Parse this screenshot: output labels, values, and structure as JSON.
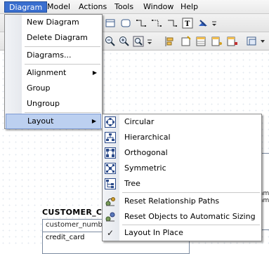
{
  "menubar": {
    "items": [
      {
        "label": "Diagram"
      },
      {
        "label": "Model"
      },
      {
        "label": "Actions"
      },
      {
        "label": "Tools"
      },
      {
        "label": "Window"
      },
      {
        "label": "Help"
      }
    ]
  },
  "diagram_menu": {
    "items": [
      {
        "label": "New Diagram"
      },
      {
        "label": "Delete Diagram"
      },
      {
        "label": "Diagrams..."
      },
      {
        "label": "Alignment"
      },
      {
        "label": "Group"
      },
      {
        "label": "Ungroup"
      },
      {
        "label": "Layout"
      }
    ]
  },
  "layout_menu": {
    "items": [
      {
        "label": "Circular",
        "icon": "circular-layout-icon"
      },
      {
        "label": "Hierarchical",
        "icon": "hierarchical-layout-icon"
      },
      {
        "label": "Orthogonal",
        "icon": "orthogonal-layout-icon"
      },
      {
        "label": "Symmetric",
        "icon": "symmetric-layout-icon"
      },
      {
        "label": "Tree",
        "icon": "tree-layout-icon"
      },
      {
        "label": "Reset Relationship Paths",
        "icon": "reset-paths-icon"
      },
      {
        "label": "Reset Objects to Automatic Sizing",
        "icon": "reset-sizing-icon"
      },
      {
        "label": "Layout In Place",
        "icon": "check-icon",
        "checked": true
      }
    ]
  },
  "entity": {
    "title": "CUSTOMER_CR",
    "pk_field": "customer_numbe",
    "row1": "credit_card"
  },
  "colors": {
    "menu_highlight": "#bcd0f0",
    "menubar_active": "#3a6fcf"
  }
}
